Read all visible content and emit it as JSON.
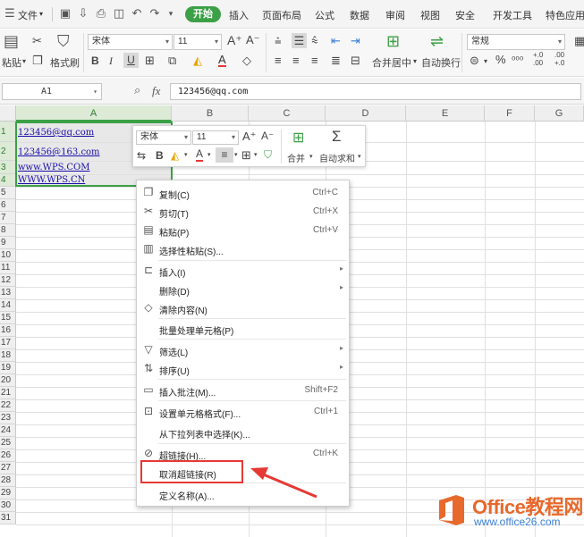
{
  "menubar": {
    "file": "文件",
    "tabs": [
      "开始",
      "插入",
      "页面布局",
      "公式",
      "数据",
      "审阅",
      "视图",
      "安全",
      "开发工具",
      "特色应用"
    ]
  },
  "ribbon": {
    "paste": "粘贴",
    "format_painter": "格式刷",
    "font_name": "宋体",
    "font_size": "11",
    "merge_center": "合并居中",
    "wrap_text": "自动换行",
    "number_format": "常规",
    "percent": "%",
    "inc_decimal": "+.0\n.00",
    "dec_decimal": ".00\n+.0"
  },
  "formulabar": {
    "cell_ref": "A1",
    "fx": "fx",
    "content": "123456@qq.com"
  },
  "grid": {
    "columns": [
      "A",
      "B",
      "C",
      "D",
      "E",
      "F",
      "G"
    ],
    "rows": [
      "1",
      "2",
      "3",
      "4",
      "5",
      "6",
      "7",
      "8",
      "9",
      "10",
      "11",
      "12",
      "13",
      "14",
      "15",
      "16",
      "17",
      "18",
      "19",
      "20",
      "21",
      "22",
      "23",
      "24",
      "25",
      "26",
      "27",
      "28",
      "29",
      "30",
      "31"
    ],
    "cells": [
      "123456@qq.com",
      "123456@163.com",
      "www.WPS.COM",
      "WWW.WPS.CN"
    ]
  },
  "mini_toolbar": {
    "font_name": "宋体",
    "font_size": "11",
    "merge": "合并",
    "autosum": "自动求和"
  },
  "context_menu": [
    {
      "label": "复制(C)",
      "shortcut": "Ctrl+C",
      "icon": "copy-icon"
    },
    {
      "label": "剪切(T)",
      "shortcut": "Ctrl+X",
      "icon": "scissors-icon"
    },
    {
      "label": "粘贴(P)",
      "shortcut": "Ctrl+V",
      "icon": "paste-icon"
    },
    {
      "label": "选择性粘贴(S)...",
      "shortcut": "",
      "icon": "paste-special-icon"
    },
    {
      "label": "插入(I)",
      "shortcut": "",
      "icon": "insert-icon"
    },
    {
      "label": "删除(D)",
      "shortcut": "",
      "icon": ""
    },
    {
      "label": "清除内容(N)",
      "shortcut": "",
      "icon": "eraser-icon"
    },
    {
      "label": "批量处理单元格(P)",
      "shortcut": "",
      "icon": ""
    },
    {
      "label": "筛选(L)",
      "shortcut": "",
      "icon": "filter-icon"
    },
    {
      "label": "排序(U)",
      "shortcut": "",
      "icon": "sort-icon"
    },
    {
      "label": "插入批注(M)...",
      "shortcut": "Shift+F2",
      "icon": "comment-icon"
    },
    {
      "label": "设置单元格格式(F)...",
      "shortcut": "Ctrl+1",
      "icon": "format-cells-icon"
    },
    {
      "label": "从下拉列表中选择(K)...",
      "shortcut": "",
      "icon": ""
    },
    {
      "label": "超链接(H)...",
      "shortcut": "Ctrl+K",
      "icon": "link-icon"
    },
    {
      "label": "取消超链接(R)",
      "shortcut": "",
      "icon": ""
    },
    {
      "label": "定义名称(A)...",
      "shortcut": "",
      "icon": ""
    }
  ],
  "watermark": {
    "title": "Office教程网",
    "url": "www.office26.com"
  },
  "colors": {
    "accent_green": "#3ca046",
    "highlight_red": "#e53935",
    "watermark_orange": "#e8692c"
  }
}
